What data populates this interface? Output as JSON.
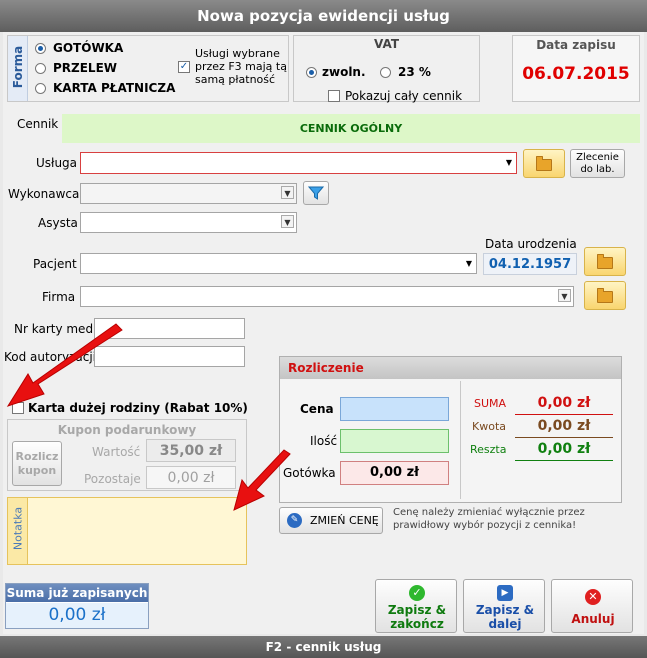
{
  "window": {
    "title": "Nowa pozycja ewidencji usług"
  },
  "payment": {
    "group_label": "Forma",
    "options": [
      "GOTÓWKA",
      "PRZELEW",
      "KARTA PŁATNICZA"
    ],
    "selected": 0,
    "same_payment_note": "Usługi wybrane przez F3 mają tą samą płatność",
    "same_payment_checked": true
  },
  "vat": {
    "title": "VAT",
    "option_exempt": "zwoln.",
    "option_23": "23 %",
    "show_all_label": "Pokazuj cały cennik"
  },
  "date_panel": {
    "title": "Data zapisu",
    "value": "06.07.2015"
  },
  "price_list": {
    "label": "Cennik",
    "value": "CENNIK OGÓLNY"
  },
  "form": {
    "service_label": "Usługa",
    "lab_order_button": "Zlecenie do lab.",
    "performer_label": "Wykonawca",
    "assist_label": "Asysta",
    "birth_date_label": "Data urodzenia",
    "birth_date_value": "04.12.1957",
    "patient_label": "Pacjent",
    "company_label": "Firma",
    "card_no_label": "Nr karty med.",
    "auth_code_label": "Kod autoryzacji"
  },
  "large_family": {
    "label": "Karta dużej rodziny (Rabat 10%)"
  },
  "coupon": {
    "title": "Kupon podarunkowy",
    "settle_button": "Rozlicz kupon",
    "value_label": "Wartość",
    "value": "35,00 zł",
    "remaining_label": "Pozostaje",
    "remaining": "0,00 zł"
  },
  "settlement": {
    "title": "Rozliczenie",
    "price_label": "Cena",
    "qty_label": "Ilość",
    "cash_label": "Gotówka",
    "cash_value": "0,00 zł",
    "sum_label": "SUMA",
    "sum_value": "0,00 zł",
    "amount_label": "Kwota",
    "amount_value": "0,00 zł",
    "change_label": "Reszta",
    "change_value": "0,00 zł"
  },
  "note": {
    "label": "Notatka"
  },
  "change_price": {
    "button": "ZMIEŃ CENĘ",
    "hint": "Cenę należy zmieniać wyłącznie przez prawidłowy wybór pozycji z cennika!"
  },
  "saved_sum": {
    "title": "Suma już zapisanych",
    "value": "0,00 zł"
  },
  "actions": {
    "save_close": "Zapisz & zakończ",
    "save_next": "Zapisz & dalej",
    "cancel": "Anuluj"
  },
  "status_bar": {
    "text": "F2 - cennik usług"
  },
  "colors": {
    "green_panel": "#ddf7c8",
    "red_value": "#e00000",
    "date_blue": "#1060b0"
  }
}
